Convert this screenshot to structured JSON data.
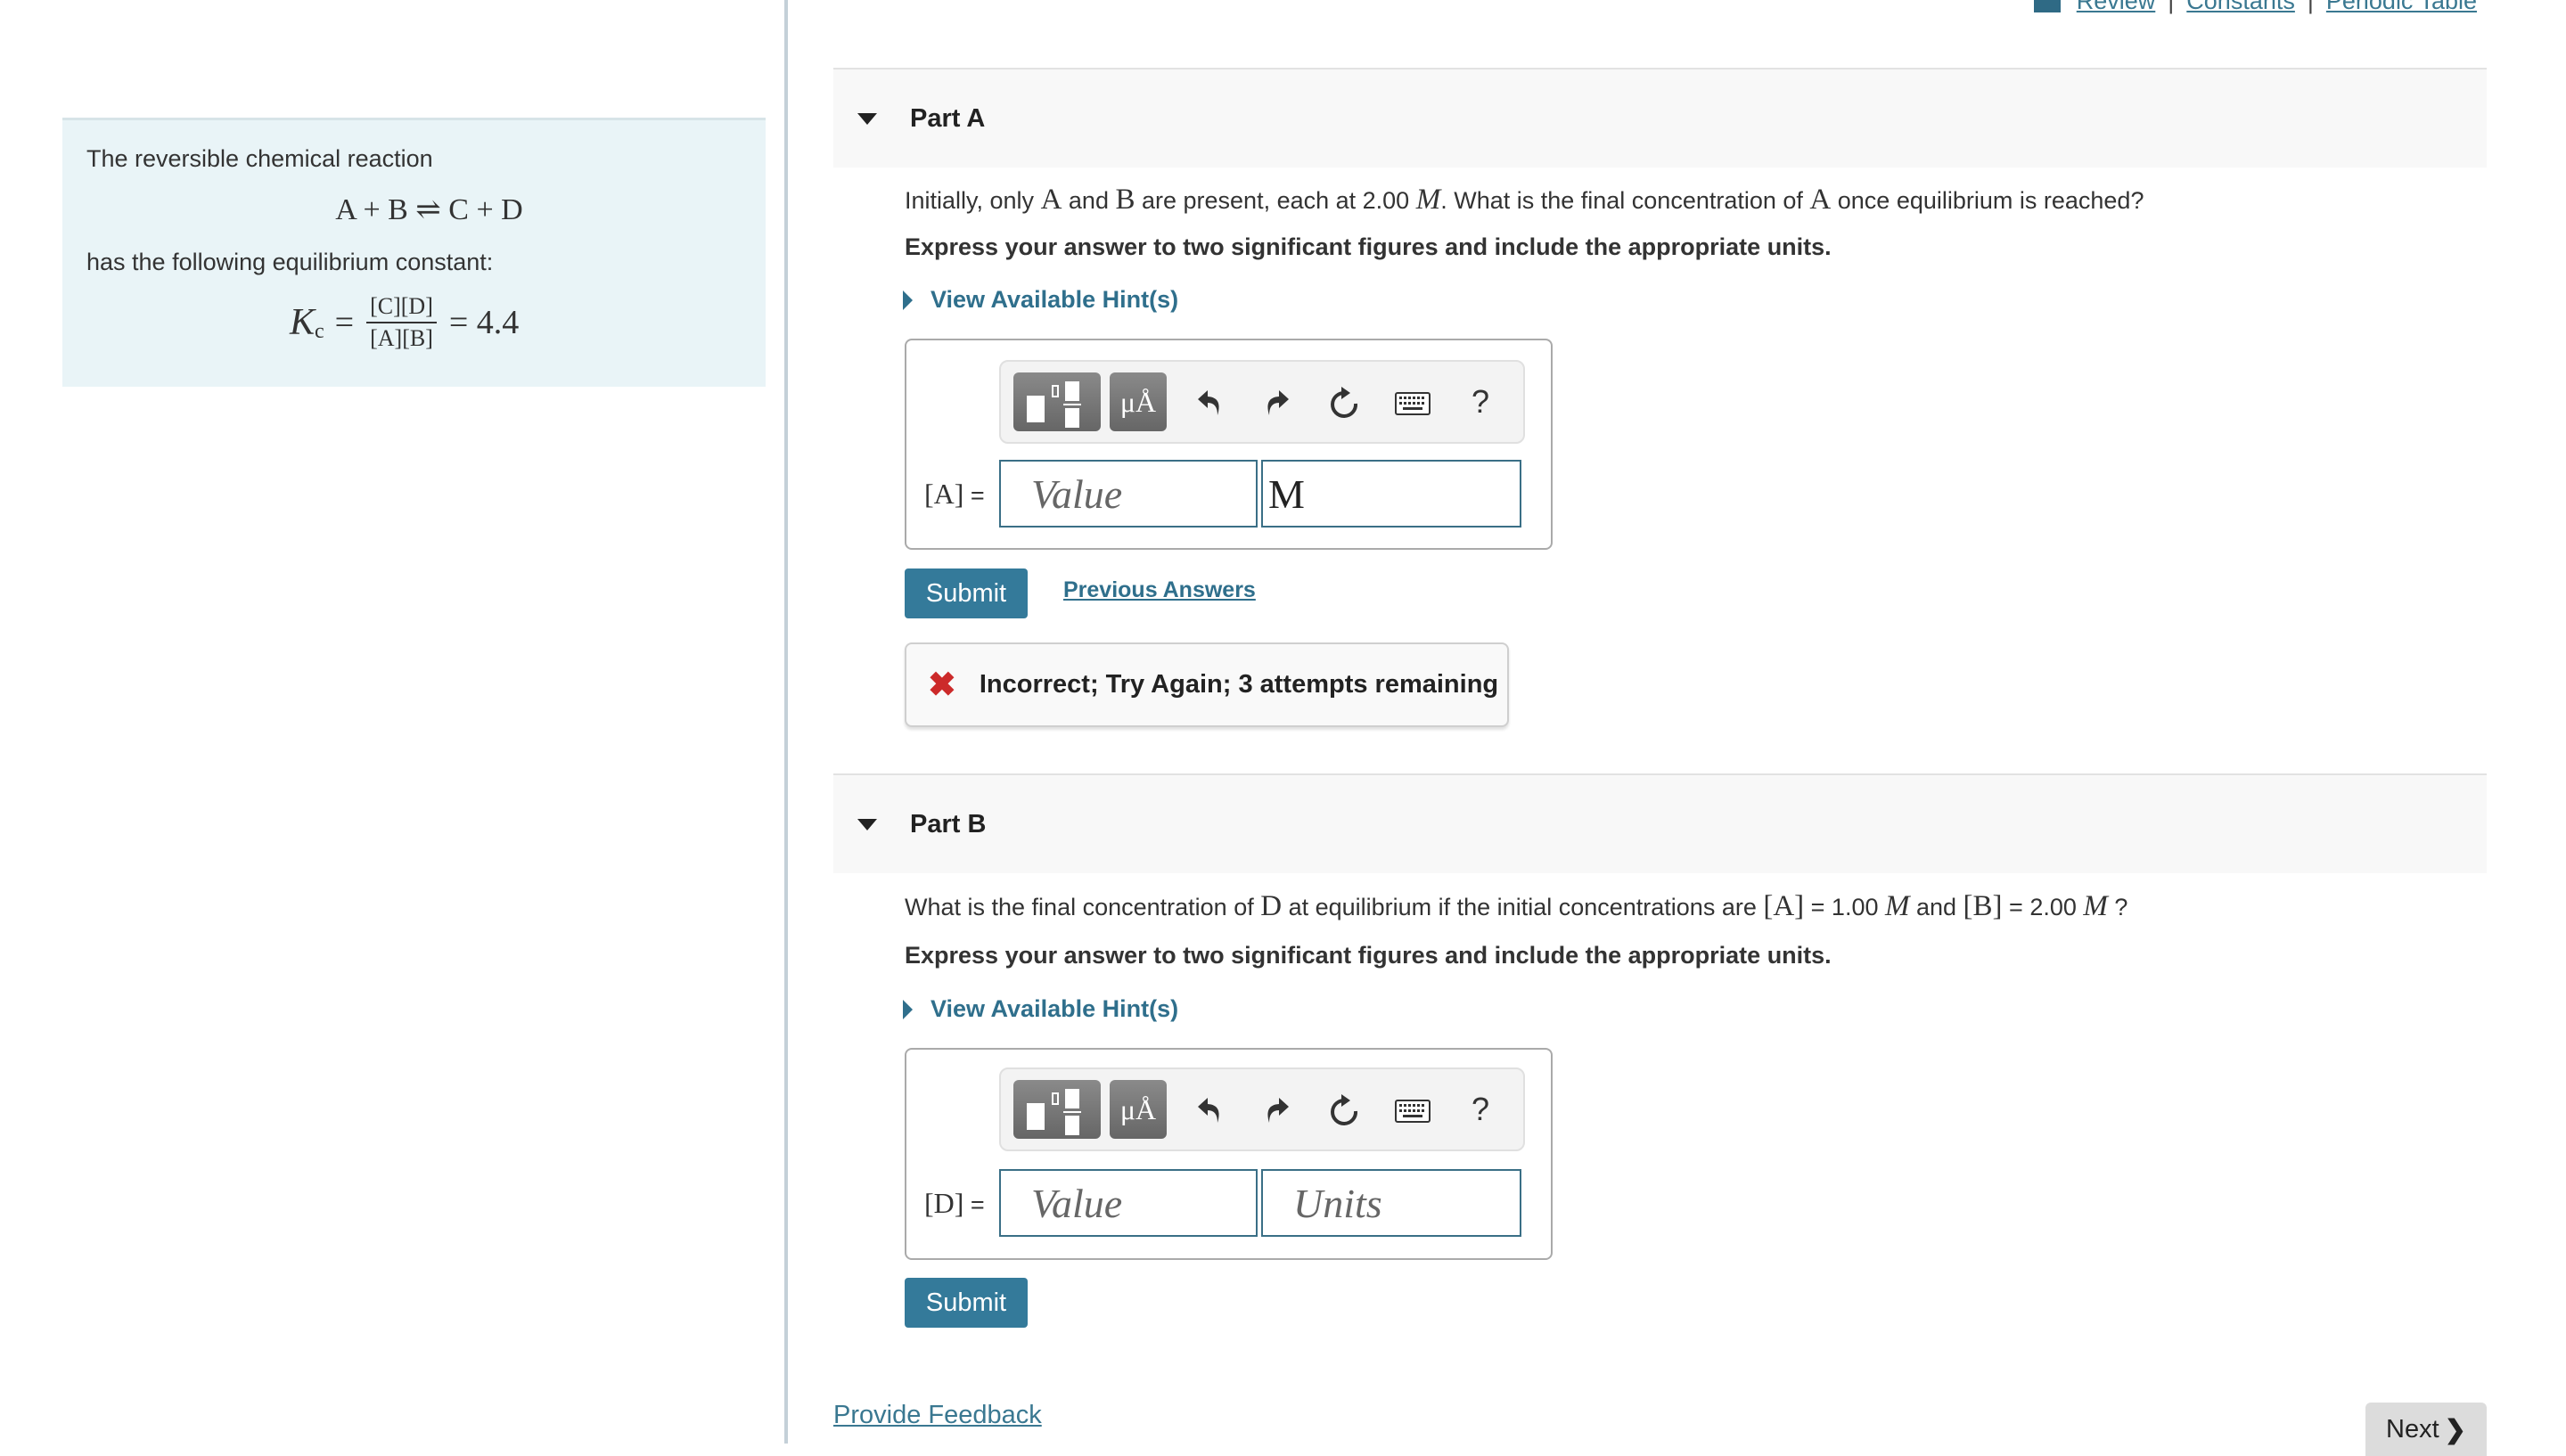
{
  "top_links": {
    "review": "Review",
    "separator": "|",
    "constants": "Constants",
    "periodic_table": "Periodic Table"
  },
  "intro": {
    "line1": "The reversible chemical reaction",
    "reaction": "A + B ⇌ C + D",
    "line2": "has the following equilibrium constant:",
    "kc_symbol": "K",
    "kc_sub": "c",
    "eq1": "=",
    "numerator": "[C][D]",
    "denominator": "[A][B]",
    "eq2": "= 4.4"
  },
  "part_a": {
    "title": "Part A",
    "question": {
      "t1": "Initially, only ",
      "a": "A",
      "t2": " and ",
      "b": "B",
      "t3": " are present, each at 2.00 ",
      "m": "M",
      "t4": ". What is the final concentration of ",
      "a2": "A",
      "t5": " once equilibrium is reached?"
    },
    "instruction": "Express your answer to two significant figures and include the appropriate units.",
    "hint_label": "View Available Hint(s)",
    "toolbar": {
      "units_label": "μÅ",
      "undo": "undo",
      "redo": "redo",
      "reset": "reset",
      "keyboard": "keyboard",
      "help": "?"
    },
    "field_label": "[A]",
    "field_eq": " =",
    "value_placeholder": "Value",
    "units_value": "M",
    "submit_label": "Submit",
    "previous_answers_label": "Previous Answers",
    "feedback": "Incorrect; Try Again; 3 attempts remaining"
  },
  "part_b": {
    "title": "Part B",
    "question": {
      "t1": "What is the final concentration of ",
      "d": "D",
      "t2": " at equilibrium if the initial concentrations are ",
      "a": "[A]",
      "t3": " = 1.00 ",
      "m1": "M",
      "t4": " and ",
      "b": "[B]",
      "t5": " = 2.00 ",
      "m2": "M",
      "t6": " ?"
    },
    "instruction": "Express your answer to two significant figures and include the appropriate units.",
    "hint_label": "View Available Hint(s)",
    "toolbar": {
      "units_label": "μÅ",
      "help": "?"
    },
    "field_label": "[D]",
    "field_eq": " =",
    "value_placeholder": "Value",
    "units_placeholder": "Units",
    "submit_label": "Submit"
  },
  "footer": {
    "provide_feedback": "Provide Feedback",
    "next_label": "Next",
    "next_icon": "❯"
  },
  "colors": {
    "accent": "#347a9a",
    "link": "#2f6f8c",
    "error": "#cc2a2a",
    "intro_bg": "#e9f4f7"
  }
}
